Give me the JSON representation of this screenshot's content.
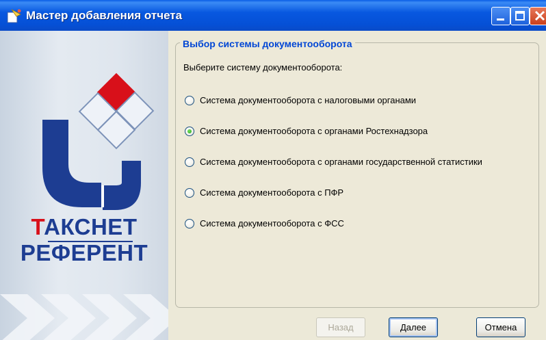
{
  "window": {
    "title": "Мастер добавления отчета",
    "controls": [
      "minimize",
      "maximize",
      "close"
    ],
    "title_icon": "wizard-icon"
  },
  "branding": {
    "line1": "ТАКСНЕТ",
    "line2": "РЕФЕРЕНТ",
    "colors": {
      "blue": "#1d3d92",
      "red": "#d8101a"
    }
  },
  "group": {
    "title": "Выбор системы документооборота",
    "prompt": "Выберите систему документооборота:",
    "options": [
      {
        "label": "Система документооборота с налоговыми органами",
        "selected": false
      },
      {
        "label": "Система документооборота с органами Ростехнадзора",
        "selected": true
      },
      {
        "label": "Система документооборота с органами государственной статистики",
        "selected": false
      },
      {
        "label": "Система документооборота с ПФР",
        "selected": false
      },
      {
        "label": "Система документооборота с ФСС",
        "selected": false
      }
    ]
  },
  "buttons": {
    "back": {
      "label": "Назад",
      "enabled": false
    },
    "next": {
      "label": "Далее",
      "enabled": true,
      "default": true
    },
    "cancel": {
      "label": "Отмена",
      "enabled": true
    }
  }
}
